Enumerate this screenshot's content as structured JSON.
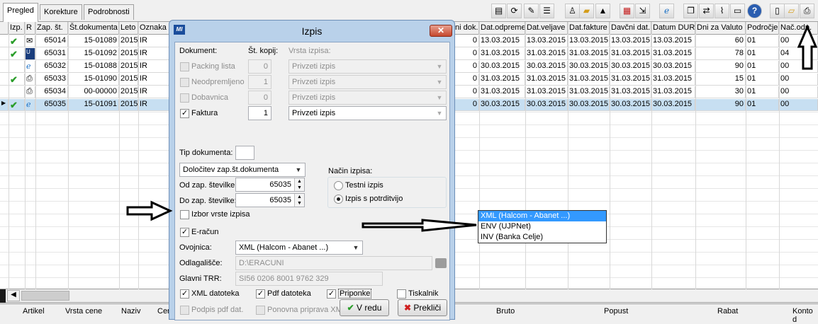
{
  "tabs": [
    {
      "label": "Pregled",
      "active": true
    },
    {
      "label": "Korekture",
      "active": false
    },
    {
      "label": "Podrobnosti",
      "active": false
    }
  ],
  "toolbar_icons": [
    "document-icon",
    "refresh-icon",
    "tools-icon",
    "list-icon",
    "user-icon",
    "folder-open-icon",
    "triangle-icon",
    "pdf-icon",
    "export-icon",
    "ie-icon",
    "copy-icon",
    "transfer-icon",
    "attach-icon",
    "note-icon",
    "help-icon",
    "new-icon",
    "open-folder-icon",
    "print-icon"
  ],
  "grid": {
    "headers_left": [
      "Izp.",
      "R",
      "Zap. št.",
      "Št.dokumenta",
      "Leto",
      "Oznaka"
    ],
    "headers_right": [
      "ni dok.",
      "Dat.odpreme",
      "Dat.veljave",
      "Dat.fakture",
      "Davčni dat.",
      "Datum DUR",
      "Dni za Valuto",
      "Področje",
      "Nač.odp."
    ],
    "rows": [
      {
        "zap": "65014",
        "dok": "15-01089",
        "leto": "2015",
        "oznaka": "IR",
        "ni": "0",
        "odpreme": "13.03.2015",
        "veljave": "13.03.2015",
        "fakture": "13.03.2015",
        "davcni": "13.03.2015",
        "dur": "13.03.2015",
        "valuta": "60",
        "podrocje": "01",
        "nac": "00",
        "check": true,
        "icon": "envelope-icon",
        "selected": false
      },
      {
        "zap": "65031",
        "dok": "15-01092",
        "leto": "2015",
        "oznaka": "IR",
        "ni": "0",
        "odpreme": "31.03.2015",
        "veljave": "31.03.2015",
        "fakture": "31.03.2015",
        "davcni": "31.03.2015",
        "dur": "31.03.2015",
        "valuta": "78",
        "podrocje": "01",
        "nac": "04",
        "check": true,
        "icon": "ujpnet-icon",
        "selected": false
      },
      {
        "zap": "65032",
        "dok": "15-01088",
        "leto": "2015",
        "oznaka": "IR",
        "ni": "0",
        "odpreme": "30.03.2015",
        "veljave": "30.03.2015",
        "fakture": "30.03.2015",
        "davcni": "30.03.2015",
        "dur": "30.03.2015",
        "valuta": "90",
        "podrocje": "01",
        "nac": "00",
        "check": false,
        "icon": "ie-icon",
        "selected": false
      },
      {
        "zap": "65033",
        "dok": "15-01090",
        "leto": "2015",
        "oznaka": "IR",
        "ni": "0",
        "odpreme": "31.03.2015",
        "veljave": "31.03.2015",
        "fakture": "31.03.2015",
        "davcni": "31.03.2015",
        "dur": "31.03.2015",
        "valuta": "15",
        "podrocje": "01",
        "nac": "00",
        "check": true,
        "icon": "printer-icon",
        "selected": false
      },
      {
        "zap": "65034",
        "dok": "00-00000",
        "leto": "2015",
        "oznaka": "IR",
        "ni": "0",
        "odpreme": "31.03.2015",
        "veljave": "31.03.2015",
        "fakture": "31.03.2015",
        "davcni": "31.03.2015",
        "dur": "31.03.2015",
        "valuta": "30",
        "podrocje": "01",
        "nac": "00",
        "check": false,
        "icon": "printer-icon",
        "selected": false
      },
      {
        "zap": "65035",
        "dok": "15-01091",
        "leto": "2015",
        "oznaka": "IR",
        "ni": "0",
        "odpreme": "30.03.2015",
        "veljave": "30.03.2015",
        "fakture": "30.03.2015",
        "davcni": "30.03.2015",
        "dur": "30.03.2015",
        "valuta": "90",
        "podrocje": "01",
        "nac": "00",
        "check": true,
        "icon": "ie-icon",
        "selected": true
      }
    ]
  },
  "bottom_headers": [
    "Artikel",
    "Vrsta cene",
    "Naziv",
    "Cen",
    "Bruto",
    "Popust",
    "Rabat",
    "Konto d"
  ],
  "dialog": {
    "title": "Izpis",
    "icon_text": "MI",
    "close": "✕",
    "col_dokument": "Dokument:",
    "col_kopij": "Št. kopij:",
    "col_vrsta": "Vrsta izpisa:",
    "docs": [
      {
        "label": "Packing lista",
        "copies": "0",
        "vrsta": "Privzeti izpis",
        "checked": false,
        "enabled": false
      },
      {
        "label": "Neodpremljeno",
        "copies": "1",
        "vrsta": "Privzeti izpis",
        "checked": false,
        "enabled": false
      },
      {
        "label": "Dobavnica",
        "copies": "0",
        "vrsta": "Privzeti izpis",
        "checked": false,
        "enabled": false
      },
      {
        "label": "Faktura",
        "copies": "1",
        "vrsta": "Privzeti izpis",
        "checked": true,
        "enabled": true
      }
    ],
    "tip_label": "Tip dokumenta:",
    "tip_value": "",
    "dolocitev": "Določitev zap.št.dokumenta",
    "od_label": "Od zap. številke:",
    "od_value": "65035",
    "do_label": "Do zap. številke:",
    "do_value": "65035",
    "nacin_label": "Način izpisa:",
    "nacin_options": [
      {
        "label": "Testni izpis",
        "selected": false
      },
      {
        "label": "Izpis s potrditvijo",
        "selected": true
      }
    ],
    "izbor_label": "Izbor vrste izpisa",
    "eracun_label": "E-račun",
    "ovojnica_label": "Ovojnica:",
    "ovojnica_value": "XML (Halcom - Abanet ...)",
    "odlagalisce_label": "Odlagališče:",
    "odlagalisce_value": "D:\\ERACUNI",
    "trr_label": "Glavni TRR:",
    "trr_value": "SI56 0206 8001 9762 329",
    "xml_label": "XML datoteka",
    "pdf_label": "Pdf datoteka",
    "priponke_label": "Priponke",
    "tiskalnik_label": "Tiskalnik",
    "podpis_label": "Podpis pdf dat.",
    "ponovna_label": "Ponovna priprava XML",
    "ok_label": "V redu",
    "cancel_label": "Prekliči"
  },
  "ovojnica_options": [
    {
      "label": "XML (Halcom - Abanet ...)",
      "highlighted": true
    },
    {
      "label": "ENV (UJPNet)",
      "highlighted": false
    },
    {
      "label": "INV (Banka Celje)",
      "highlighted": false
    }
  ],
  "colors": {
    "selected_row": "#c7dff2",
    "dialog_frame": "#b9d1ea",
    "highlight": "#3399ff",
    "check_green": "#2a9d2a"
  }
}
